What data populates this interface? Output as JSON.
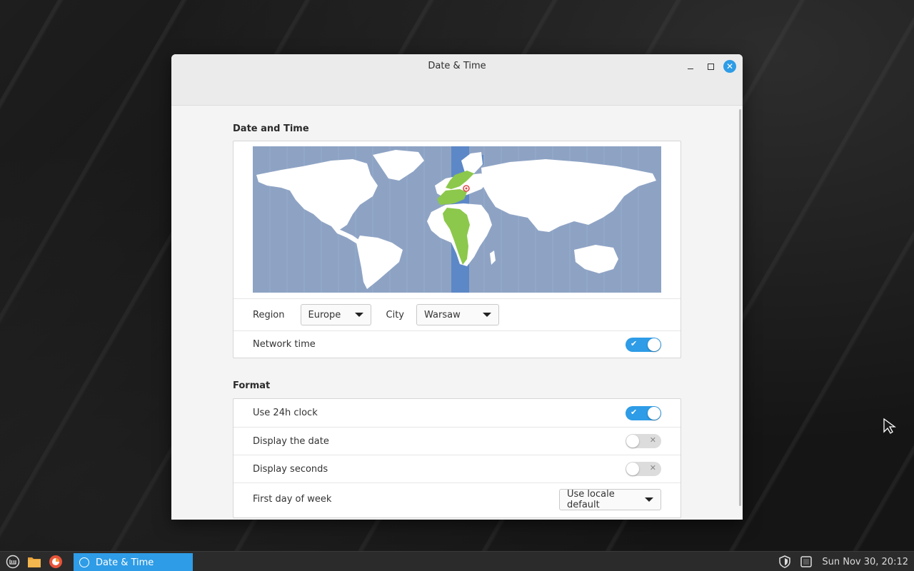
{
  "window": {
    "title": "Date & Time"
  },
  "date_time_section": {
    "title": "Date and Time",
    "region_label": "Region",
    "region_value": "Europe",
    "city_label": "City",
    "city_value": "Warsaw",
    "network_time_label": "Network time",
    "network_time_on": true
  },
  "format_section": {
    "title": "Format",
    "use_24h_label": "Use 24h clock",
    "use_24h_on": true,
    "display_date_label": "Display the date",
    "display_date_on": false,
    "display_seconds_label": "Display seconds",
    "display_seconds_on": false,
    "first_day_label": "First day of week",
    "first_day_value": "Use locale default"
  },
  "taskbar": {
    "active_task_label": "Date & Time",
    "clock": "Sun Nov 30, 20:12"
  },
  "colors": {
    "accent": "#2e9ce6",
    "map_ocean": "#8ea3c4",
    "map_land": "#ffffff",
    "timezone_band": "#5d88c7",
    "timezone_land": "#8cc84b"
  },
  "icons": {
    "menu": "mint-menu-icon",
    "files": "folder-icon",
    "browser": "firefox-icon",
    "task": "clock-icon",
    "tray_security": "shield-icon",
    "tray_display": "display-icon"
  }
}
